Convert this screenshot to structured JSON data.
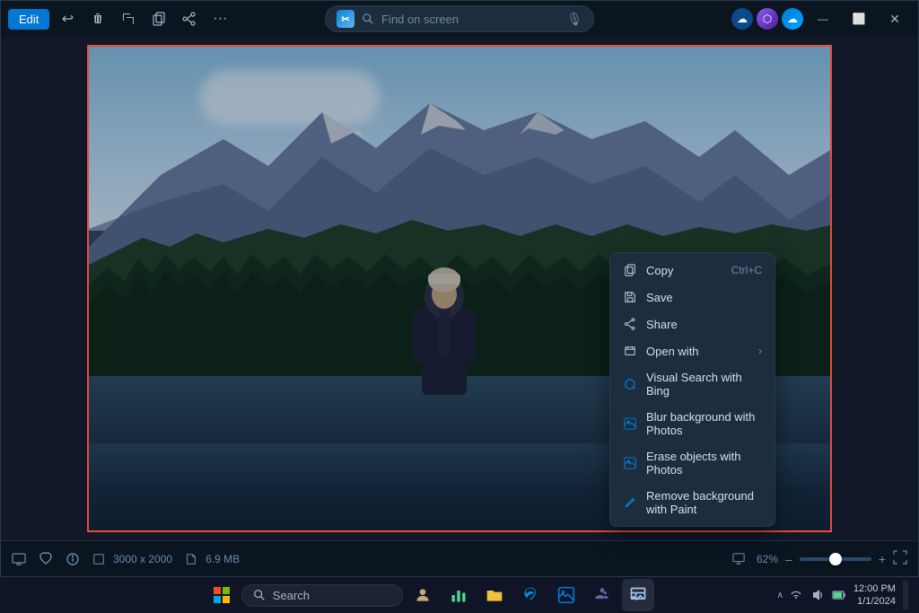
{
  "titlebar": {
    "edit_label": "Edit",
    "search_placeholder": "Find on screen",
    "app_logo": "📷"
  },
  "toolbar": {
    "icons": [
      "↩",
      "🗑",
      "⊟",
      "⊡",
      "⬜",
      "···"
    ]
  },
  "context_menu": {
    "items": [
      {
        "id": "copy",
        "label": "Copy",
        "shortcut": "Ctrl+C",
        "icon": "copy"
      },
      {
        "id": "save",
        "label": "Save",
        "shortcut": "",
        "icon": "save"
      },
      {
        "id": "share",
        "label": "Share",
        "shortcut": "",
        "icon": "share"
      },
      {
        "id": "open_with",
        "label": "Open with",
        "shortcut": "",
        "icon": "open",
        "has_arrow": true
      },
      {
        "id": "visual_search",
        "label": "Visual Search with Bing",
        "shortcut": "",
        "icon": "bing"
      },
      {
        "id": "blur_bg",
        "label": "Blur background with Photos",
        "shortcut": "",
        "icon": "photos"
      },
      {
        "id": "erase_objects",
        "label": "Erase objects with Photos",
        "shortcut": "",
        "icon": "photos"
      },
      {
        "id": "remove_bg",
        "label": "Remove background with Paint",
        "shortcut": "",
        "icon": "paint"
      }
    ]
  },
  "status_bar": {
    "dimensions": "3000 x 2000",
    "file_size": "6.9 MB",
    "zoom": "62%"
  },
  "taskbar": {
    "search_placeholder": "Search",
    "time": "Time",
    "icons": [
      "🪟",
      "🔍",
      "👤",
      "📊",
      "🗂",
      "🌐",
      "📱",
      "🎵",
      "💬"
    ]
  }
}
